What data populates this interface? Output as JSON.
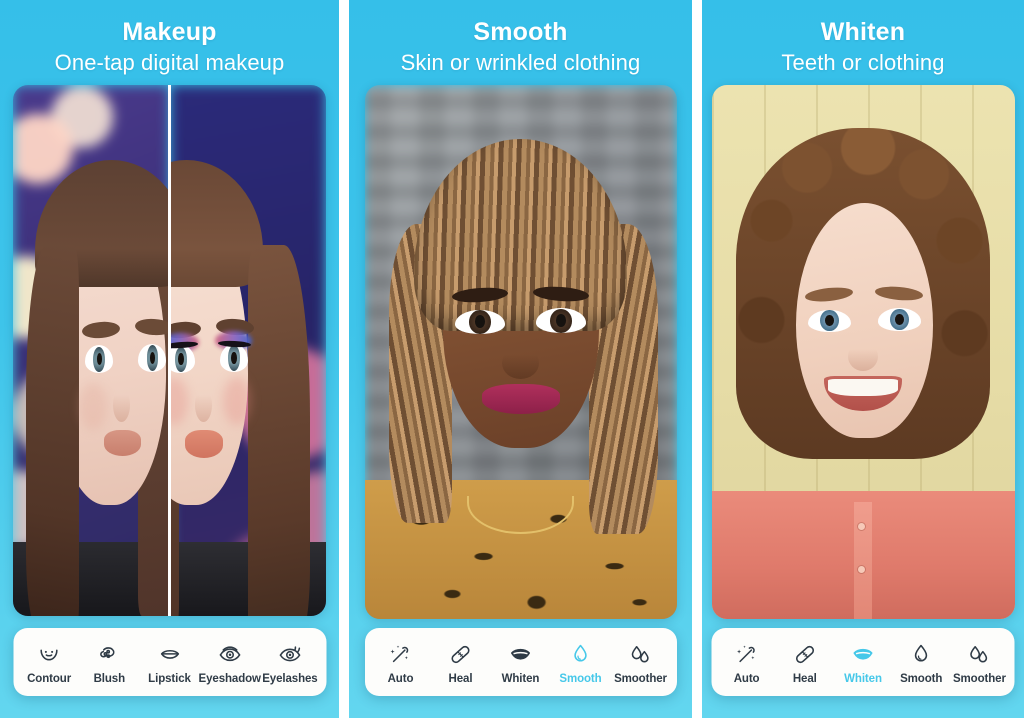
{
  "theme": {
    "background_top": "#35bfe9",
    "background_bottom": "#63d6ef",
    "card_background": "#fdfdfb",
    "label_color": "#2f3b46",
    "active_color": "#46c8e9",
    "gap_color": "#ffffff"
  },
  "panels": [
    {
      "id": "makeup",
      "title": "Makeup",
      "subtitle": "One-tap digital makeup",
      "photo_alt": "Before and after split portrait of a woman with long brown hair on a purple bokeh background",
      "split_view": true,
      "tools": [
        {
          "label": "Contour",
          "icon": "contour-face-icon",
          "active": false
        },
        {
          "label": "Blush",
          "icon": "blush-icon",
          "active": false
        },
        {
          "label": "Lipstick",
          "icon": "lips-icon",
          "active": false
        },
        {
          "label": "Eyeshadow",
          "icon": "eye-icon",
          "active": false
        },
        {
          "label": "Eyelashes",
          "icon": "eyelash-eye-icon",
          "active": false
        }
      ]
    },
    {
      "id": "smooth",
      "title": "Smooth",
      "subtitle": "Skin or wrinkled clothing",
      "photo_alt": "Portrait of a woman with blonde box braids and a leopard print shirt",
      "split_view": false,
      "tools": [
        {
          "label": "Auto",
          "icon": "magic-wand-icon",
          "active": false
        },
        {
          "label": "Heal",
          "icon": "bandage-icon",
          "active": false
        },
        {
          "label": "Whiten",
          "icon": "teeth-smile-icon",
          "active": false
        },
        {
          "label": "Smooth",
          "icon": "droplet-icon",
          "active": true
        },
        {
          "label": "Smoother",
          "icon": "two-droplets-icon",
          "active": false
        }
      ]
    },
    {
      "id": "whiten",
      "title": "Whiten",
      "subtitle": "Teeth or clothing",
      "photo_alt": "Portrait of a smiling woman with curly auburn hair in a coral shirt on a yellow wall",
      "split_view": false,
      "tools": [
        {
          "label": "Auto",
          "icon": "magic-wand-icon",
          "active": false
        },
        {
          "label": "Heal",
          "icon": "bandage-icon",
          "active": false
        },
        {
          "label": "Whiten",
          "icon": "teeth-smile-icon",
          "active": true
        },
        {
          "label": "Smooth",
          "icon": "droplet-icon",
          "active": false
        },
        {
          "label": "Smoother",
          "icon": "two-droplets-icon",
          "active": false
        }
      ]
    }
  ]
}
